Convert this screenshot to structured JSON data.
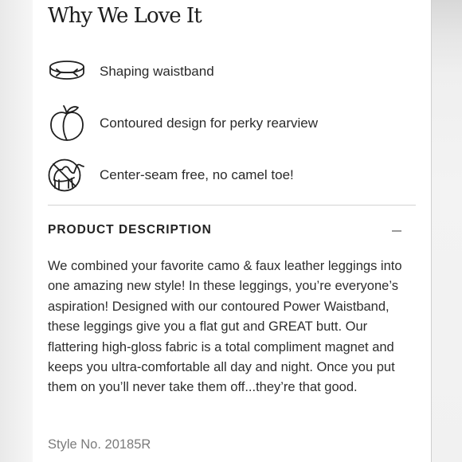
{
  "section_title": "Why We Love It",
  "features": [
    {
      "icon": "waistband-icon",
      "label": "Shaping waistband"
    },
    {
      "icon": "peach-icon",
      "label": "Contoured design for perky rearview"
    },
    {
      "icon": "no-camel-icon",
      "label": "Center-seam free, no camel toe!"
    }
  ],
  "product_description": {
    "title": "PRODUCT DESCRIPTION",
    "toggle_icon": "minus-icon",
    "text": "We combined your favorite camo & faux leather leggings into one amazing new style! In these leggings, you’re everyone’s aspiration! Designed with our contoured Power Waistband, these leggings give you a flat gut and GREAT butt. Our flattering high-gloss fabric is a total compliment magnet and keeps you ultra-comfortable all day and night. Once you put them on you’ll never take them off...they’re that good.",
    "style_number": "Style No. 20185R"
  },
  "colors": {
    "text": "#2a2a2a",
    "muted": "#7b7b7b",
    "divider": "#d3d3d3"
  }
}
